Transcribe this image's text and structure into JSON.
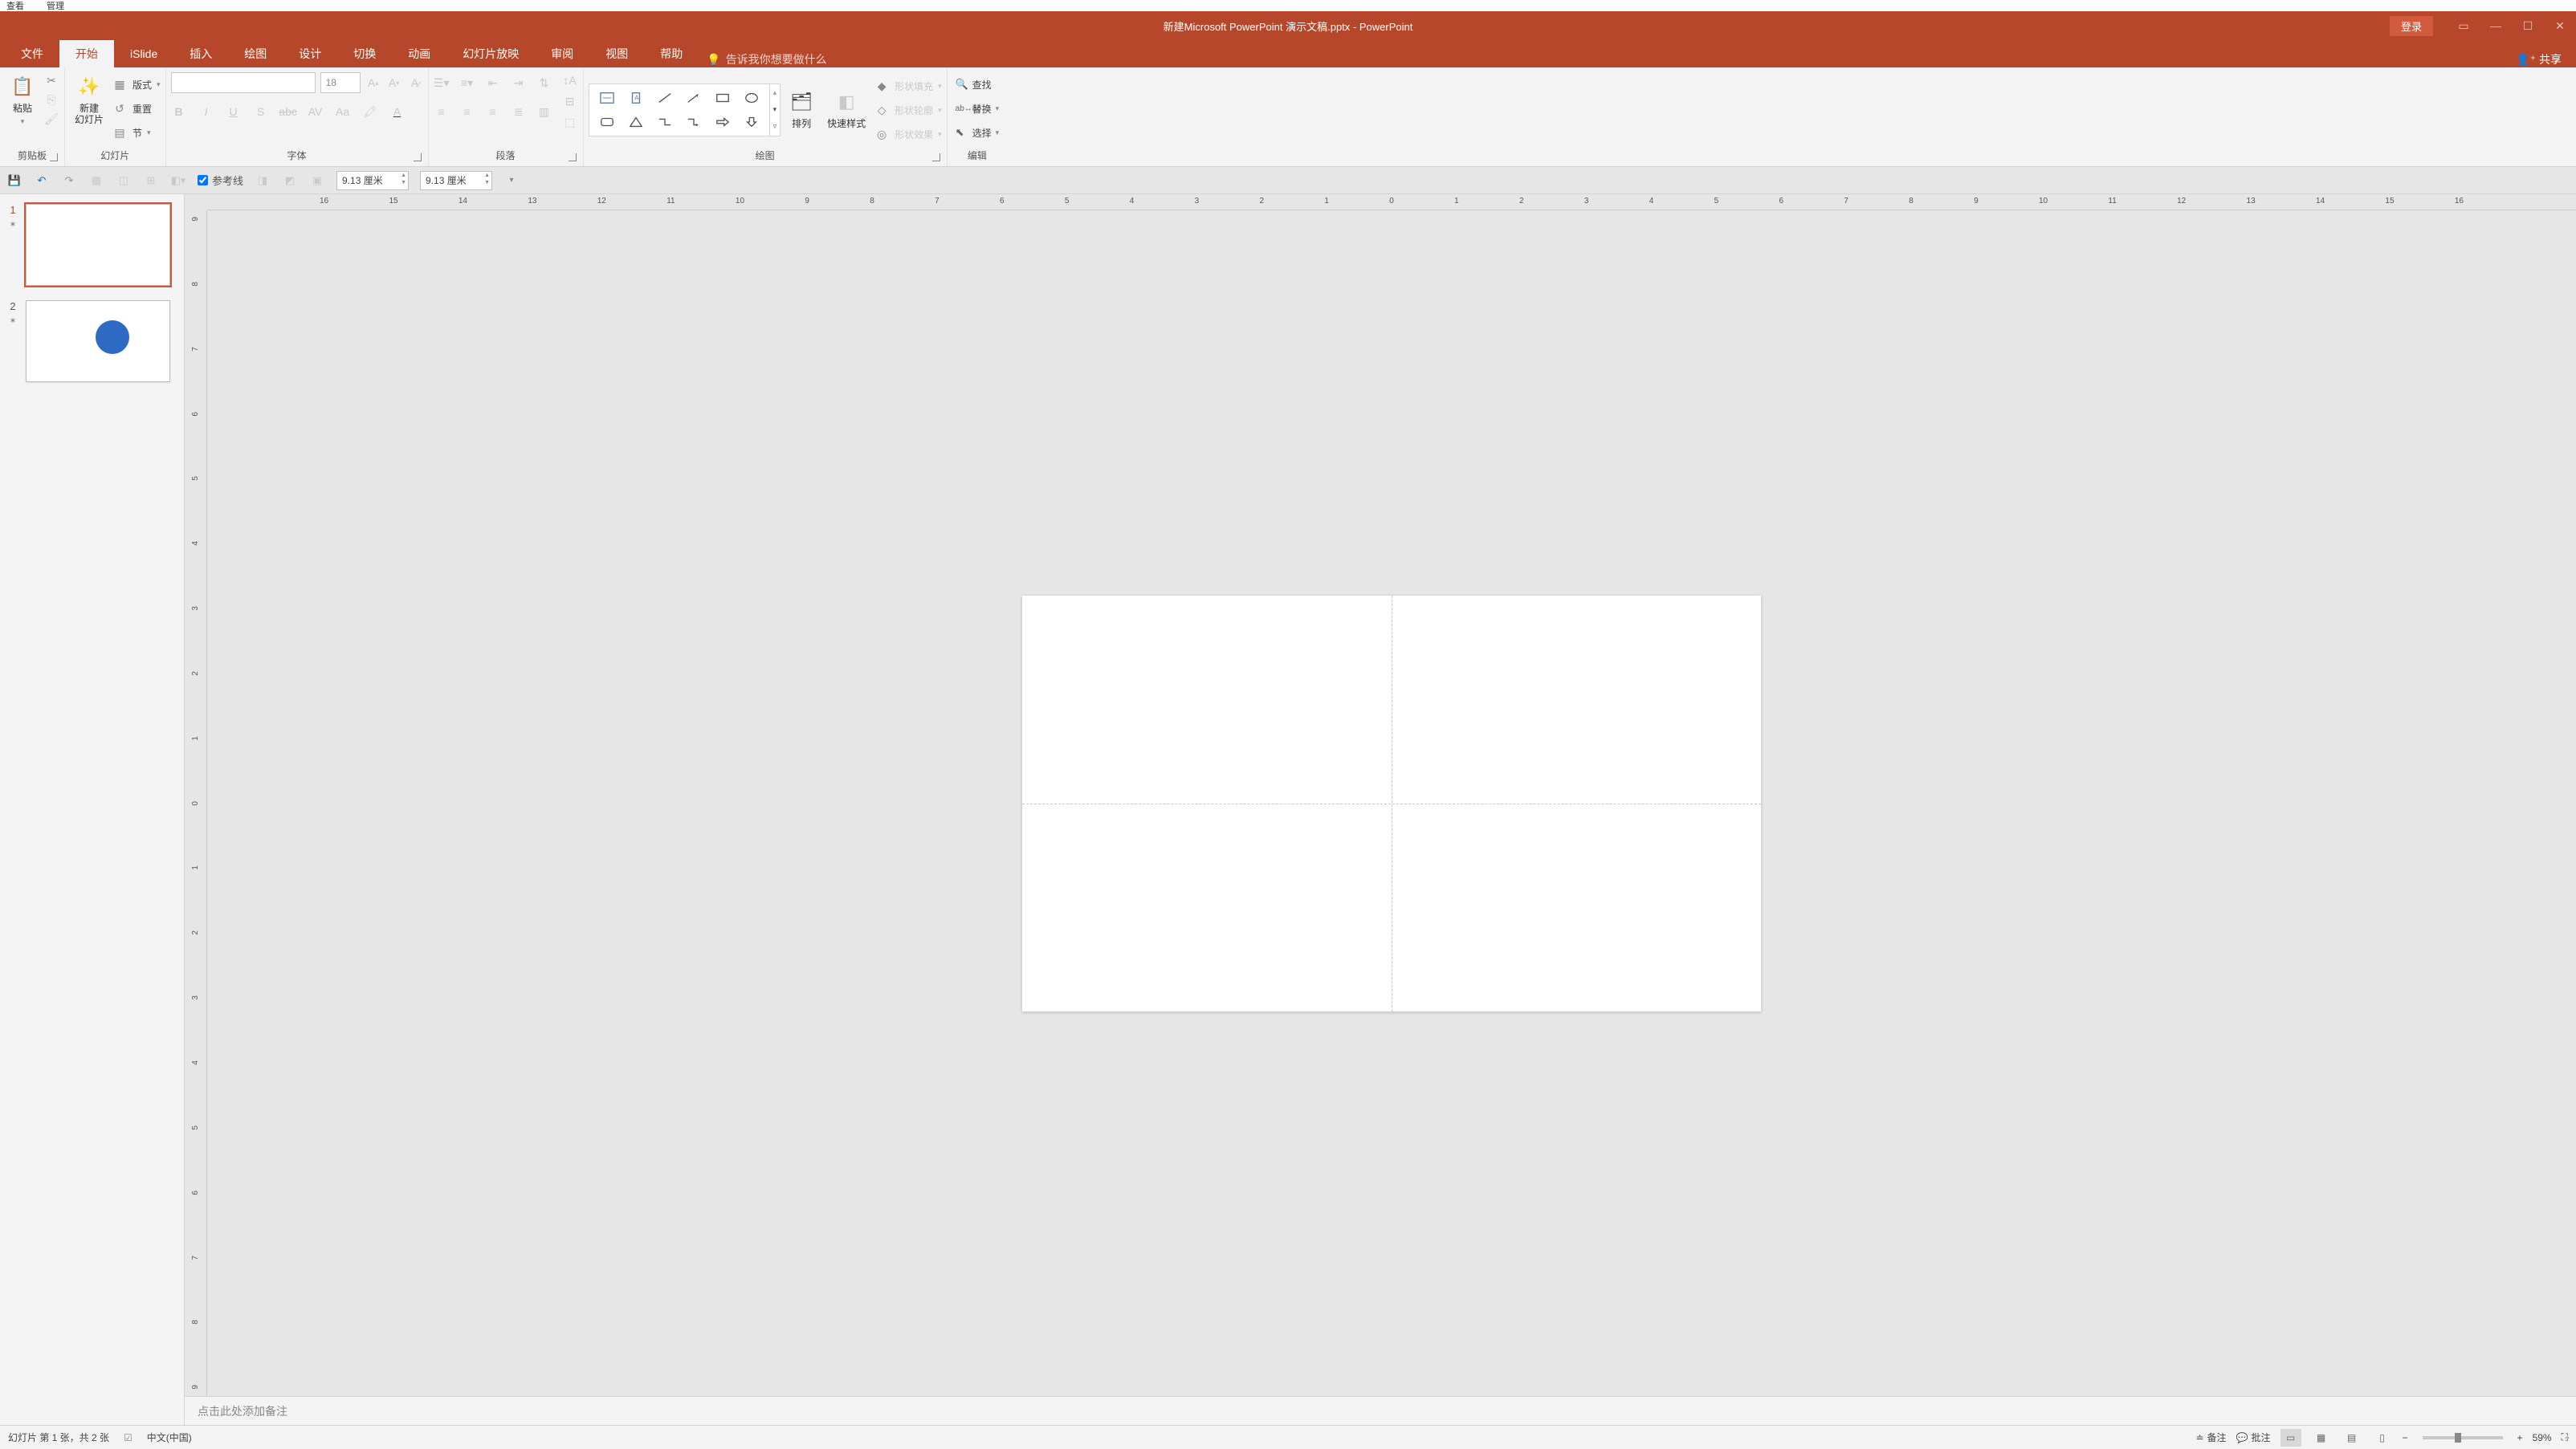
{
  "topmenu": {
    "item1": "查看",
    "item2": "管理"
  },
  "titlebar": {
    "filename": "新建Microsoft PowerPoint 演示文稿.pptx",
    "appname": "PowerPoint",
    "sep": "  -  ",
    "login": "登录"
  },
  "tabs": {
    "file": "文件",
    "home": "开始",
    "islide": "iSlide",
    "insert": "插入",
    "draw": "绘图",
    "design": "设计",
    "transitions": "切换",
    "animations": "动画",
    "slideshow": "幻灯片放映",
    "review": "审阅",
    "view": "视图",
    "help": "帮助",
    "tellme": "告诉我你想要做什么",
    "share": "共享"
  },
  "ribbon": {
    "clipboard": {
      "paste": "粘贴",
      "label": "剪贴板"
    },
    "slides": {
      "newslide": "新建\n幻灯片",
      "layout": "版式",
      "reset": "重置",
      "section": "节",
      "label": "幻灯片"
    },
    "font": {
      "size": "18",
      "label": "字体"
    },
    "paragraph": {
      "label": "段落"
    },
    "drawing": {
      "arrange": "排列",
      "quickstyles": "快速样式",
      "fill": "形状填充",
      "outline": "形状轮廓",
      "effects": "形状效果",
      "label": "绘图"
    },
    "editing": {
      "find": "查找",
      "replace": "替换",
      "select": "选择",
      "label": "编辑"
    }
  },
  "quickbar": {
    "guides": "参考线",
    "width": "9.13 厘米",
    "height": "9.13 厘米"
  },
  "ruler_h": [
    "16",
    "15",
    "14",
    "13",
    "12",
    "11",
    "10",
    "9",
    "8",
    "7",
    "6",
    "5",
    "4",
    "3",
    "2",
    "1",
    "0",
    "1",
    "2",
    "3",
    "4",
    "5",
    "6",
    "7",
    "8",
    "9",
    "10",
    "11",
    "12",
    "13",
    "14",
    "15",
    "16"
  ],
  "ruler_v": [
    "9",
    "8",
    "7",
    "6",
    "5",
    "4",
    "3",
    "2",
    "1",
    "0",
    "1",
    "2",
    "3",
    "4",
    "5",
    "6",
    "7",
    "8",
    "9"
  ],
  "slides_panel": [
    {
      "num": "1",
      "active": true,
      "has_circle": false
    },
    {
      "num": "2",
      "active": false,
      "has_circle": true
    }
  ],
  "notes": {
    "placeholder": "点击此处添加备注"
  },
  "status": {
    "slideinfo": "幻灯片 第 1 张，共 2 张",
    "lang": "中文(中国)",
    "notesbtn": "备注",
    "comments": "批注",
    "zoom": "59%"
  }
}
